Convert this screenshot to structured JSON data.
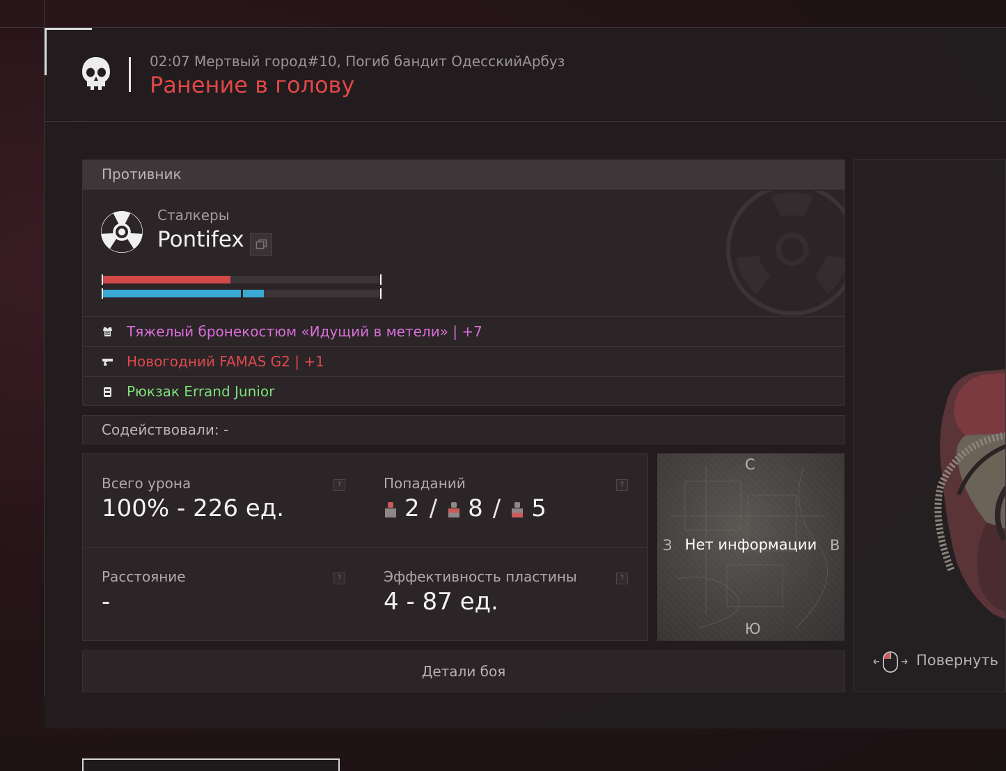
{
  "header": {
    "event_line": "02:07 Мертвый город#10, Погиб бандит ОдесскийАрбуз",
    "death_title": "Ранение в голову",
    "skull_icon": "skull-icon"
  },
  "opponent": {
    "section_title": "Противник",
    "faction": "Сталкеры",
    "name": "Pontifex",
    "faction_icon": "radiation-icon",
    "copy_icon": "copy-icon",
    "health_fill": 0.46,
    "armor_fill": 0.58,
    "equipment": [
      {
        "icon": "armor-icon",
        "text": "Тяжелый бронекостюм «Идущий в метели» | +7",
        "color": "#d86fd8"
      },
      {
        "icon": "gun-icon",
        "text": "Новогодний FAMAS G2 | +1",
        "color": "#e0484f"
      },
      {
        "icon": "backpack-icon",
        "text": "Рюкзак Errand Junior",
        "color": "#7ee07a"
      }
    ]
  },
  "assist": {
    "label": "Содействовали:",
    "value": "-"
  },
  "stats": {
    "total_damage": {
      "label": "Всего урона",
      "value": "100% - 226 ед."
    },
    "hits": {
      "label": "Попаданий",
      "head": "2",
      "body": "8",
      "legs": "5"
    },
    "distance": {
      "label": "Расстояние",
      "value": "-"
    },
    "plate": {
      "label": "Эффективность пластины",
      "value": "4 - 87 ед."
    },
    "help": "?"
  },
  "minimap": {
    "north": "С",
    "south": "Ю",
    "west": "З",
    "east": "В",
    "no_info": "Нет информации"
  },
  "details_button": "Детали боя",
  "rotate_label": "Повернуть",
  "colors": {
    "health": "#d14848",
    "armor": "#3aa9d4",
    "hit_marker": "#cc5a5a"
  }
}
